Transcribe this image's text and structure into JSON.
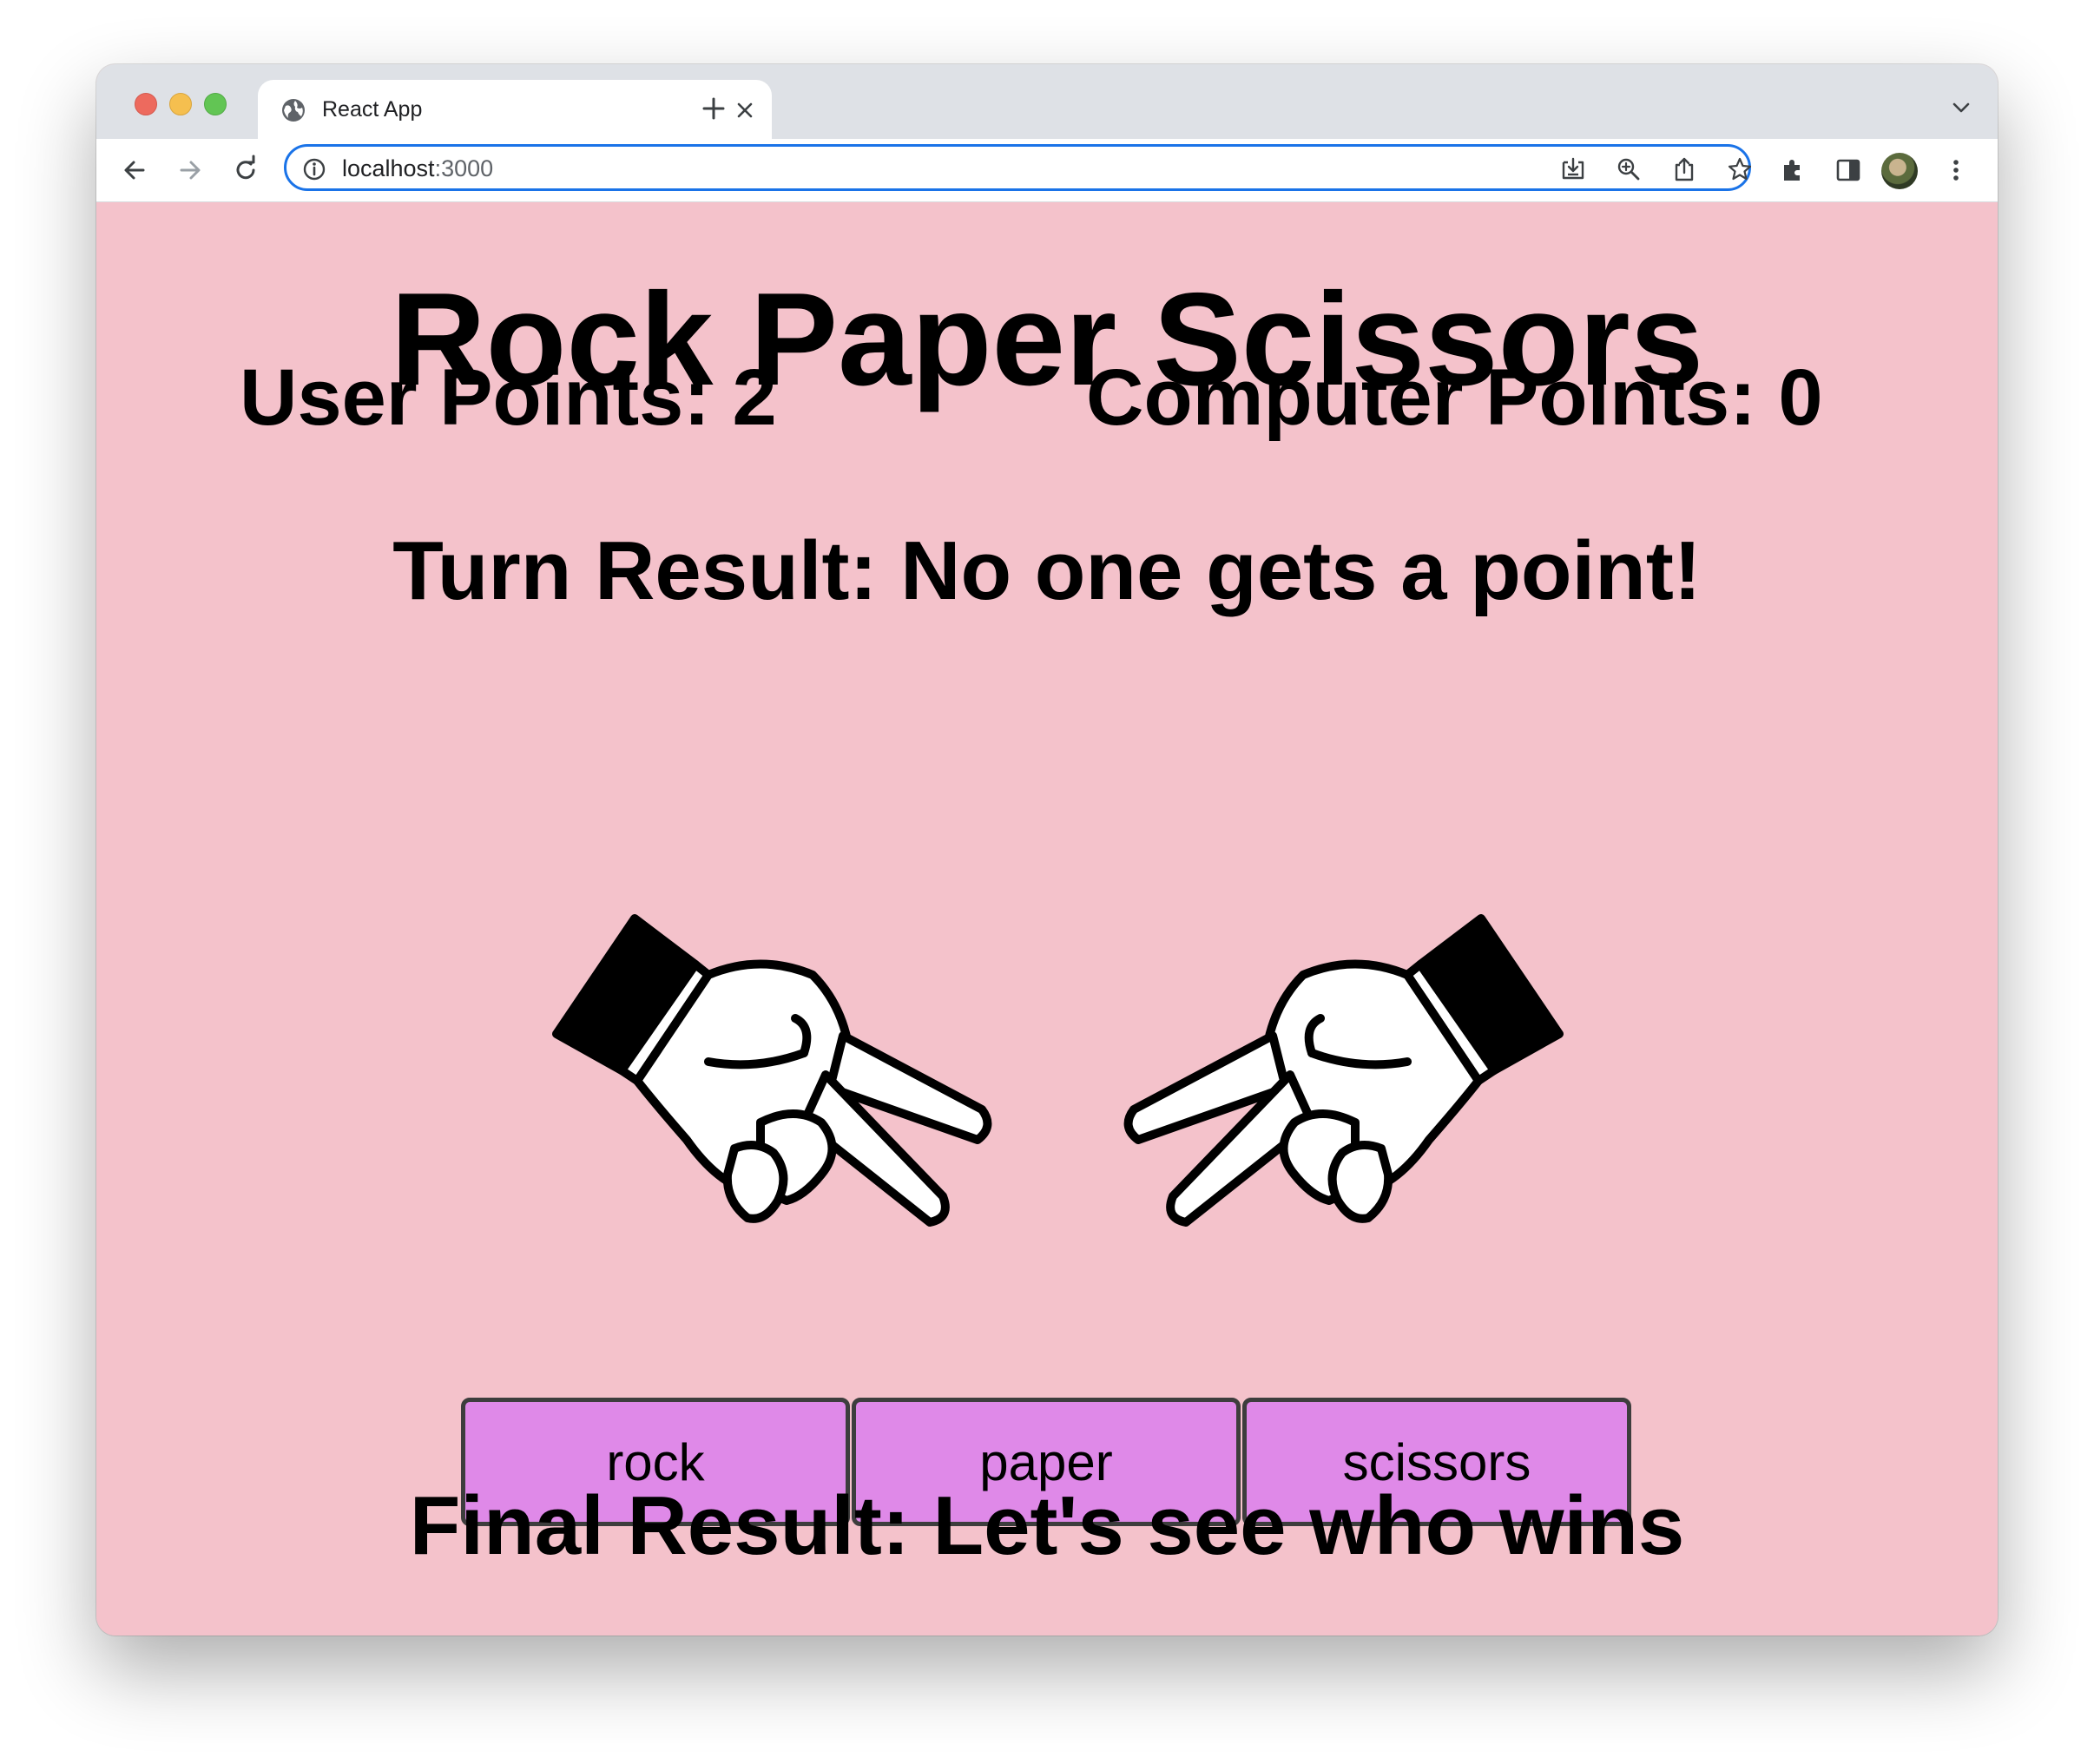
{
  "browser": {
    "tab_title": "React App",
    "url_host": "localhost",
    "url_port": ":3000"
  },
  "game": {
    "title": "Rock Paper Scissors",
    "user_points": "User Points: 2",
    "computer_points": "Computer Points: 0",
    "turn_result": "Turn Result: No one gets a point!",
    "user_hand": "scissors",
    "computer_hand": "scissors",
    "buttons": {
      "rock": "rock",
      "paper": "paper",
      "scissors": "scissors"
    },
    "final_result": "Final Result: Let's see who wins"
  },
  "colors": {
    "page_background": "#f4c2cb",
    "button_background": "#df89e8",
    "button_border": "#3d3d3d",
    "omnibox_focus": "#1a73e8"
  }
}
